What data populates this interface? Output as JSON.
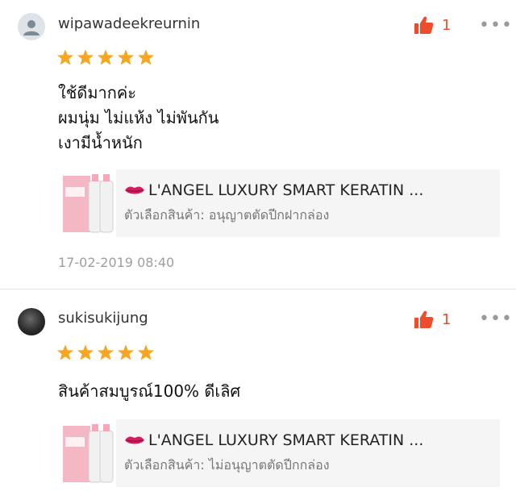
{
  "reviews": [
    {
      "username": "wipawadeekreurnin",
      "likes": "1",
      "rating": 5,
      "comment_lines": [
        "ใช้ดีมากค่ะ",
        "ผมนุ่ม ไม่แห้ง ไม่พันกัน",
        "เงามีน้ำหนัก"
      ],
      "product_name": "L'ANGEL LUXURY SMART KERATIN ...",
      "variant": "ตัวเลือกสินค้า: อนุญาตตัดปีกฝากล่อง",
      "date": "17-02-2019 08:40"
    },
    {
      "username": "sukisukijung",
      "likes": "1",
      "rating": 5,
      "comment_lines": [
        "สินค้าสมบูรณ์100% ดีเลิศ"
      ],
      "product_name": "L'ANGEL LUXURY SMART KERATIN ...",
      "variant": "ตัวเลือกสินค้า: ไม่อนุญาตตัดปีกกล่อง"
    }
  ],
  "colors": {
    "accent": "#ee4d2d",
    "star": "#f5a623",
    "lips": "#d81b60"
  },
  "icons": {
    "like": "thumbs-up-icon",
    "more": "more-dots-icon",
    "star": "star-icon",
    "lips": "lips-emoji-icon"
  }
}
